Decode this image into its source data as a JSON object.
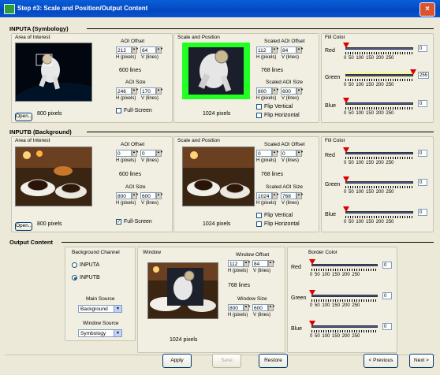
{
  "window": {
    "title": "Step #3: Scale and Position/Output Content",
    "close_glyph": "×"
  },
  "spin_arrows": "▲▼",
  "dropdown_arrow": "▼",
  "checkmark": "✓",
  "slider_scale": "0  50  100  150  200  250",
  "inputA": {
    "header": "INPUTA (Symbology)",
    "area": {
      "label": "Area of Interest",
      "aoi_offset_label": "AOI Offset",
      "h": "212",
      "v": "64",
      "h_unit": "H (pixels)",
      "v_unit": "V (lines)",
      "lines_text": "600 lines",
      "aoi_size_label": "AOI Size",
      "size_h": "246",
      "size_v": "170",
      "pixels_text": "800 pixels",
      "open_label": "Open...",
      "fullscreen_label": "Full-Screen",
      "fullscreen_checked": false
    },
    "scale": {
      "label": "Scale and Position",
      "scaled_offset_label": "Scaled AOI Offset",
      "h": "112",
      "v": "84",
      "h_unit": "H (pixels)",
      "v_unit": "V (lines)",
      "lines_text": "768 lines",
      "scaled_size_label": "Scaled AOI Size",
      "size_h": "800",
      "size_v": "600",
      "pixels_text": "1024 pixels",
      "flip_v": "Flip Vertical",
      "flip_h": "Flip Horizontal"
    },
    "fill": {
      "label": "Fill Color",
      "red_label": "Red",
      "red": "0",
      "green_label": "Green",
      "green": "255",
      "blue_label": "Blue",
      "blue": "0",
      "green_highlight": "#f7f3a0"
    }
  },
  "inputB": {
    "header": "INPUTB (Background)",
    "area": {
      "label": "Area of Interest",
      "aoi_offset_label": "AOI Offset",
      "h": "0",
      "v": "0",
      "h_unit": "H (pixels)",
      "v_unit": "V (lines)",
      "lines_text": "600 lines",
      "aoi_size_label": "AOI Size",
      "size_h": "800",
      "size_v": "600",
      "pixels_text": "800 pixels",
      "open_label": "Open...",
      "fullscreen_label": "Full-Screen",
      "fullscreen_checked": true
    },
    "scale": {
      "label": "Scale and Position",
      "scaled_offset_label": "Scaled AOI Offset",
      "h": "0",
      "v": "0",
      "h_unit": "H (pixels)",
      "v_unit": "V (lines)",
      "lines_text": "768 lines",
      "scaled_size_label": "Scaled AOI Size",
      "size_h": "1024",
      "size_v": "768",
      "pixels_text": "1024 pixels",
      "flip_v": "Flip Vertical",
      "flip_h": "Flip Horizontal"
    },
    "fill": {
      "label": "Fill Color",
      "red_label": "Red",
      "red": "0",
      "green_label": "Green",
      "green": "0",
      "blue_label": "Blue",
      "blue": "0"
    }
  },
  "output": {
    "header": "Output Content",
    "bg_channel": {
      "label": "Background Channel",
      "opt_a": "INPUTA",
      "opt_b": "INPUTB",
      "selected": "INPUTB"
    },
    "main_source": {
      "label": "Main Source",
      "value": "Background"
    },
    "window_source": {
      "label": "Window Source",
      "value": "Symbology"
    },
    "window": {
      "label": "Window",
      "offset_label": "Window Offset",
      "h": "112",
      "v": "84",
      "h_unit": "H (pixels)",
      "v_unit": "V (lines)",
      "lines_text": "768 lines",
      "size_label": "Window Size",
      "size_h": "800",
      "size_v": "600",
      "pixels_text": "1024 pixels"
    },
    "border": {
      "label": "Border Color",
      "red_label": "Red",
      "red": "0",
      "green_label": "Green",
      "green": "0",
      "blue_label": "Blue",
      "blue": "0"
    }
  },
  "buttons": {
    "apply": "Apply",
    "save": "Save",
    "restore": "Restore",
    "previous": "< Previous",
    "next": "Next >"
  },
  "colors": {
    "titlebar": "#0a5ed8",
    "green_frame": "#22ff22",
    "slider_thumb": "#dd0000"
  }
}
